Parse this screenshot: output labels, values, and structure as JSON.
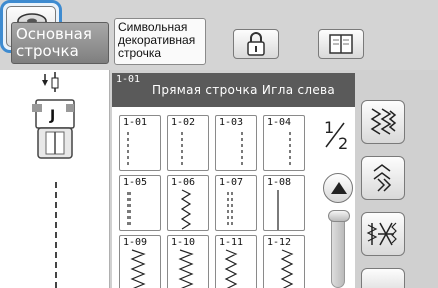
{
  "tabs": {
    "main_label_line1": "Основная",
    "main_label_line2": "строчка",
    "decorative_line1": "Символьная",
    "decorative_line2": "декоративная",
    "decorative_line3": "строчка"
  },
  "toolbar": {
    "lock_icon": "lock-icon",
    "book_icon": "book-icon",
    "spool_icon": "bobbin-spool-icon",
    "spool_highlight": "#3e8bd0"
  },
  "selected": {
    "number": "1-01",
    "title": "Прямая строчка Игла слева"
  },
  "stitches": [
    {
      "no": "1-01",
      "kind": "straight-left"
    },
    {
      "no": "1-02",
      "kind": "straight-mid"
    },
    {
      "no": "1-03",
      "kind": "straight-right"
    },
    {
      "no": "1-04",
      "kind": "straight-right2"
    },
    {
      "no": "1-05",
      "kind": "triple"
    },
    {
      "no": "1-06",
      "kind": "zigzag-tight"
    },
    {
      "no": "1-07",
      "kind": "double"
    },
    {
      "no": "1-08",
      "kind": "straight-solid"
    },
    {
      "no": "1-09",
      "kind": "zigzag"
    },
    {
      "no": "1-10",
      "kind": "zigzag"
    },
    {
      "no": "1-11",
      "kind": "zigzag-left"
    },
    {
      "no": "1-12",
      "kind": "zigzag-right"
    }
  ],
  "pager": {
    "page_text": "1/2",
    "current": "1",
    "total": "2"
  },
  "side_buttons": [
    "utility-stitch-category-icon",
    "zigzag-category-icon",
    "decorative-category-icon"
  ]
}
